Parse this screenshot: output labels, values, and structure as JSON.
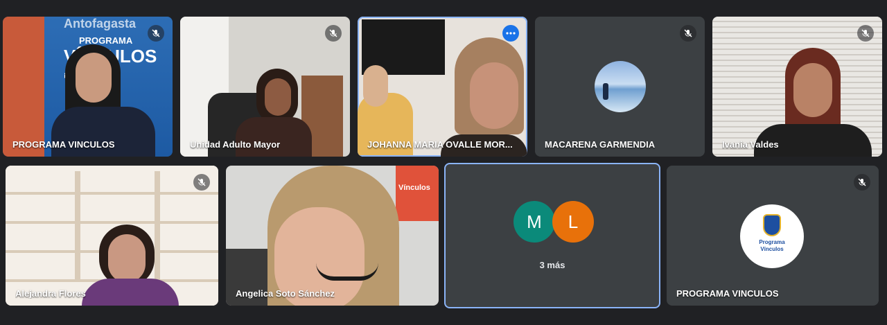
{
  "participants": [
    {
      "name": "PROGRAMA VINCULOS",
      "muted": true,
      "banner_line1": "Antofagasta",
      "banner_line2": "PROGRAMA",
      "banner_line3": "VÍNCULOS",
      "banner_line4": "¡La Pe"
    },
    {
      "name": "Unidad Adulto Mayor",
      "muted": true
    },
    {
      "name": "JOHANNA MARIA OVALLE MOR...",
      "muted": false,
      "active": true
    },
    {
      "name": "MACARENA GARMENDIA",
      "muted": true
    },
    {
      "name": "Ivania Valdes",
      "muted": true
    },
    {
      "name": "Alejandra Flores",
      "muted": true
    },
    {
      "name": "Angelica Soto Sánchez",
      "muted": false
    },
    {
      "name": "PROGRAMA VINCULOS",
      "muted": true,
      "logo_text1": "Programa",
      "logo_text2": "Vínculos"
    }
  ],
  "overflow": {
    "letters": [
      "M",
      "L"
    ],
    "colors": [
      "#0b8a7a",
      "#e8710a"
    ],
    "label": "3 más"
  },
  "poster_text": "Vínculos",
  "icons": {
    "mute": "mic-off-icon",
    "more": "more-options-icon"
  }
}
